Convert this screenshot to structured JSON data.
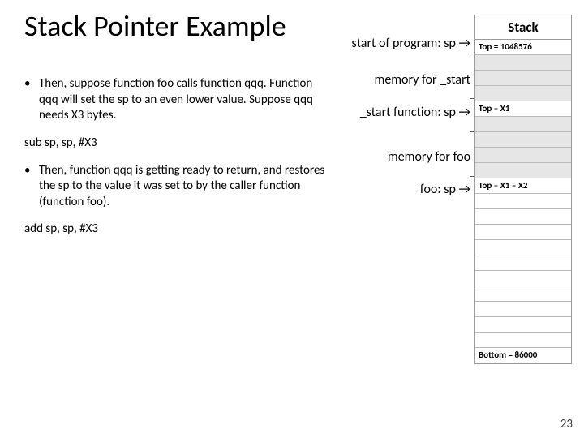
{
  "title": "Stack Pointer Example",
  "bullets": [
    "Then, suppose function foo calls function qqq. Function qqq will set the sp to an even lower value. Suppose qqq needs X3 bytes.",
    "Then, function qqq is getting ready to return, and restores the sp to the value it was set to by the caller function (function foo)."
  ],
  "code1": "sub sp, sp, #X3",
  "code2": "add sp, sp, #X3",
  "labels": {
    "l1": "start of program: sp →",
    "l2": "memory for _start",
    "l3": "_start function:  sp →",
    "l4": "memory for foo",
    "l5": "foo:  sp →"
  },
  "stack": {
    "header": "Stack",
    "top": "Top = 1048576",
    "x1": "Top – X1",
    "x2": "Top – X1 – X2",
    "bottom": "Bottom = 86000"
  },
  "page": "23"
}
